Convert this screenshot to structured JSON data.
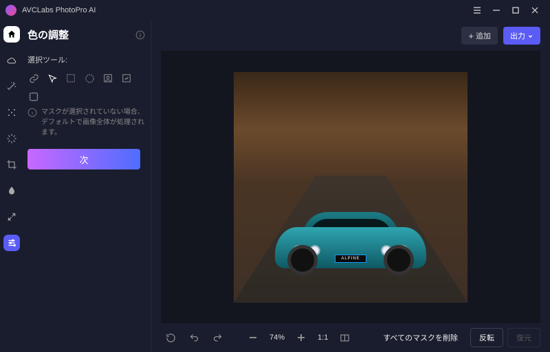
{
  "app": {
    "title": "AVCLabs PhotoPro AI"
  },
  "panel": {
    "title": "色の調整",
    "section_label": "選択ツール:",
    "hint": "マスクが選択されていない場合、デフォルトで画像全体が処理されます。",
    "next_label": "次"
  },
  "topbar": {
    "add_label": "追加",
    "output_label": "出力"
  },
  "image": {
    "plate_text": "ALPINE"
  },
  "bottombar": {
    "zoom_value": "74%",
    "ratio_label": "1:1",
    "delete_masks_label": "すべてのマスクを削除",
    "invert_label": "反転",
    "restore_label": "復元"
  }
}
